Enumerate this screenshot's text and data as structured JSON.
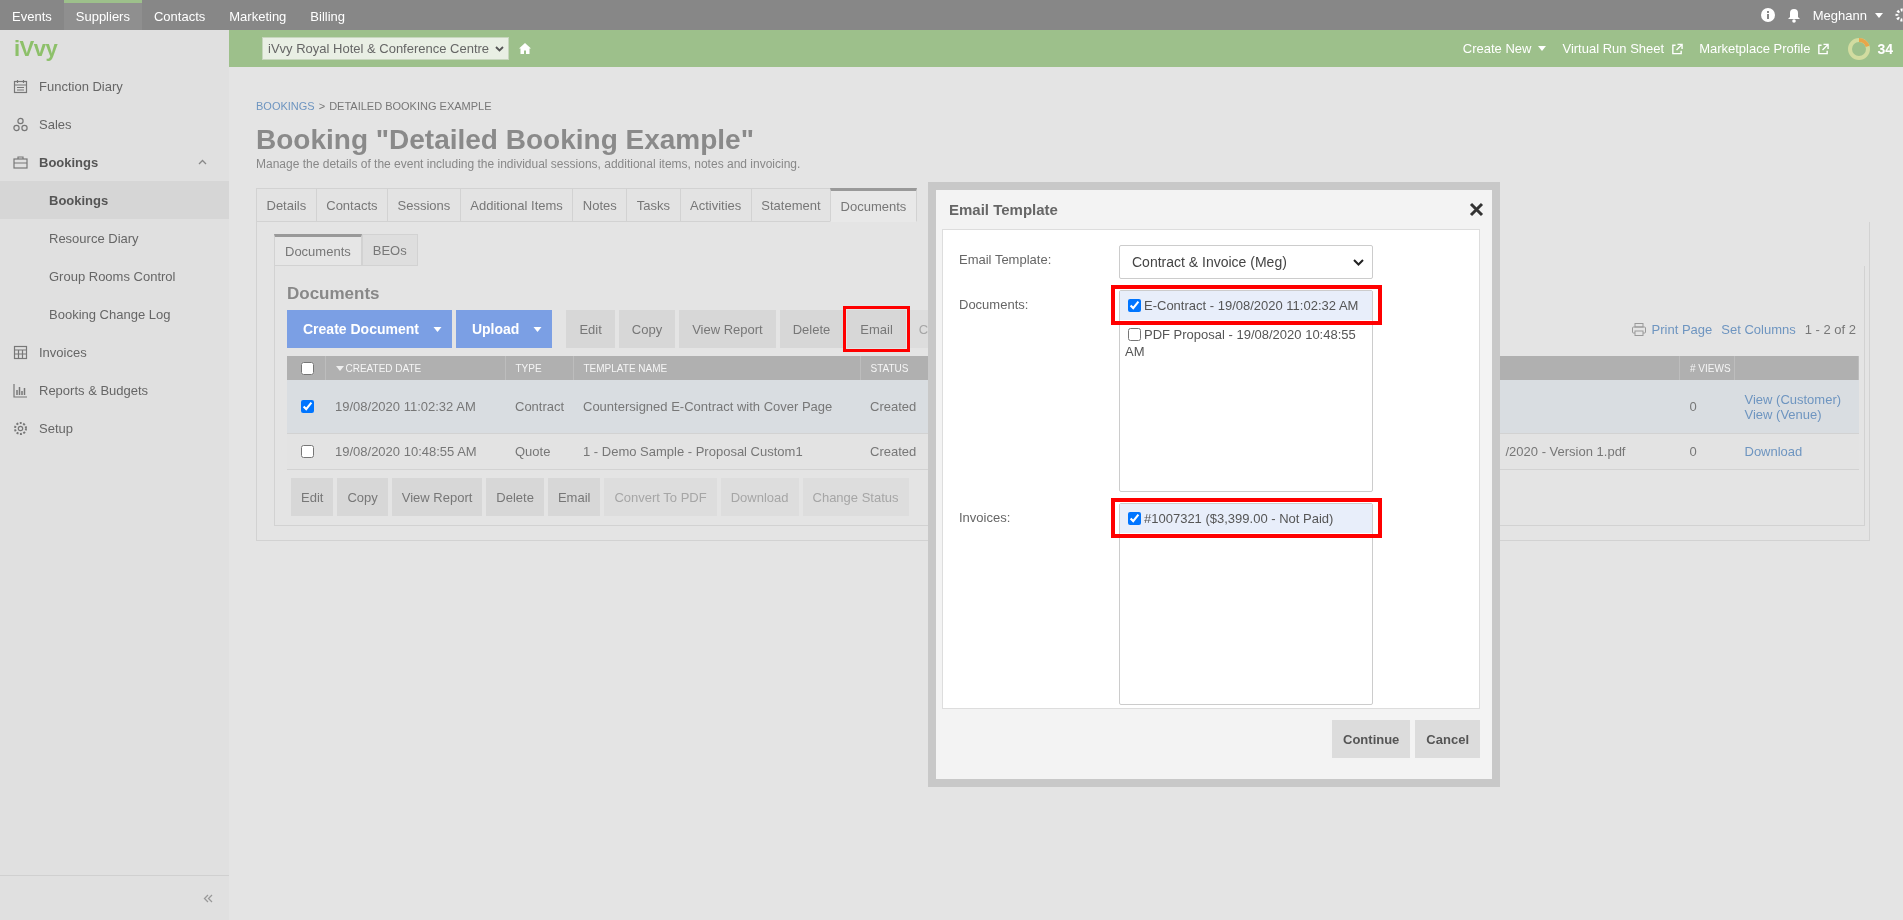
{
  "top_nav": {
    "items": [
      {
        "label": "Events",
        "selected": false
      },
      {
        "label": "Suppliers",
        "selected": true
      },
      {
        "label": "Contacts",
        "selected": false
      },
      {
        "label": "Marketing",
        "selected": false
      },
      {
        "label": "Billing",
        "selected": false
      }
    ],
    "user": "Meghann"
  },
  "venue_bar": {
    "venue": "iVvy Royal Hotel & Conference Centre",
    "links": [
      {
        "label": "Create New",
        "kind": "dropdown"
      },
      {
        "label": "Virtual Run Sheet",
        "kind": "external"
      },
      {
        "label": "Marketplace Profile",
        "kind": "external"
      }
    ],
    "score": "34"
  },
  "sidebar": {
    "logo": "iVvy",
    "items": [
      {
        "label": "Function Diary",
        "selected": false
      },
      {
        "label": "Sales",
        "selected": false
      },
      {
        "label": "Bookings",
        "selected": true,
        "expanded": true,
        "children": [
          {
            "label": "Bookings",
            "selected": true
          },
          {
            "label": "Resource Diary",
            "selected": false
          },
          {
            "label": "Group Rooms Control",
            "selected": false
          },
          {
            "label": "Booking Change Log",
            "selected": false
          }
        ]
      },
      {
        "label": "Invoices",
        "selected": false
      },
      {
        "label": "Reports & Budgets",
        "selected": false
      },
      {
        "label": "Setup",
        "selected": false
      }
    ]
  },
  "page": {
    "breadcrumb": [
      {
        "label": "BOOKINGS",
        "kind": "link"
      },
      {
        "label": "DETAILED BOOKING EXAMPLE",
        "kind": "current"
      }
    ],
    "breadcrumb_separator": ">",
    "title": "Booking \"Detailed Booking Example\"",
    "subtitle": "Manage the details of the event including the individual sessions, additional items, notes and invoicing.",
    "tabs": [
      {
        "label": "Details",
        "selected": false
      },
      {
        "label": "Contacts",
        "selected": false
      },
      {
        "label": "Sessions",
        "selected": false
      },
      {
        "label": "Additional Items",
        "selected": false
      },
      {
        "label": "Notes",
        "selected": false
      },
      {
        "label": "Tasks",
        "selected": false
      },
      {
        "label": "Activities",
        "selected": false
      },
      {
        "label": "Statement",
        "selected": false
      },
      {
        "label": "Documents",
        "selected": true
      }
    ],
    "subtabs": [
      {
        "label": "Documents",
        "selected": true
      },
      {
        "label": "BEOs",
        "selected": false
      }
    ],
    "section_title": "Documents",
    "toolbar": [
      {
        "label": "Create Document",
        "kind": "primary",
        "disabled": false,
        "highlighted": false
      },
      {
        "label": "Upload",
        "kind": "primary",
        "disabled": false,
        "highlighted": false
      },
      {
        "label": "Edit",
        "kind": "plain",
        "disabled": false,
        "highlighted": false
      },
      {
        "label": "Copy",
        "kind": "plain",
        "disabled": false,
        "highlighted": false
      },
      {
        "label": "View Report",
        "kind": "plain",
        "disabled": false,
        "highlighted": false
      },
      {
        "label": "Delete",
        "kind": "plain",
        "disabled": false,
        "highlighted": false
      },
      {
        "label": "Email",
        "kind": "plain",
        "disabled": false,
        "highlighted": true
      },
      {
        "label": "C",
        "kind": "plain",
        "disabled": true,
        "highlighted": false
      }
    ],
    "print_link": "Print Page",
    "columns_link": "Set Columns",
    "paging": "1 - 2 of 2",
    "table": {
      "all_checked": false,
      "columns": [
        "CREATED DATE",
        "TYPE",
        "TEMPLATE NAME",
        "STATUS",
        "# VIEWS"
      ],
      "rows": [
        {
          "selected": true,
          "created": "19/08/2020 11:02:32 AM",
          "type": "Contract",
          "template": "Countersigned E-Contract with Cover Page",
          "status": "Created",
          "views": "0",
          "actions": [
            "View (Customer)",
            "View (Venue)"
          ]
        },
        {
          "selected": false,
          "created": "19/08/2020 10:48:55 AM",
          "type": "Quote",
          "template": "1 - Demo Sample - Proposal Custom1",
          "status": "Created",
          "file": "/2020 - Version 1.pdf",
          "views": "0",
          "actions": [
            "Download"
          ]
        }
      ]
    },
    "bottom_toolbar": [
      {
        "label": "Edit",
        "disabled": false
      },
      {
        "label": "Copy",
        "disabled": false
      },
      {
        "label": "View Report",
        "disabled": false
      },
      {
        "label": "Delete",
        "disabled": false
      },
      {
        "label": "Email",
        "disabled": false
      },
      {
        "label": "Convert To PDF",
        "disabled": true
      },
      {
        "label": "Download",
        "disabled": true
      },
      {
        "label": "Change Status",
        "disabled": true
      }
    ]
  },
  "dialog": {
    "title": "Email Template",
    "fields": [
      {
        "label": "Email Template:",
        "kind": "select",
        "value": "Contract & Invoice (Meg)"
      },
      {
        "label": "Documents:",
        "kind": "checklist",
        "items": [
          {
            "label": "E-Contract - 19/08/2020 11:02:32 AM",
            "checked": true,
            "highlighted": true
          },
          {
            "label": "PDF Proposal - 19/08/2020 10:48:55 AM",
            "checked": false,
            "highlighted": false
          }
        ]
      },
      {
        "label": "Invoices:",
        "kind": "checklist",
        "items": [
          {
            "label": "#1007321 ($3,399.00 - Not Paid)",
            "checked": true,
            "highlighted": true
          }
        ]
      }
    ],
    "buttons": [
      "Continue",
      "Cancel"
    ]
  }
}
